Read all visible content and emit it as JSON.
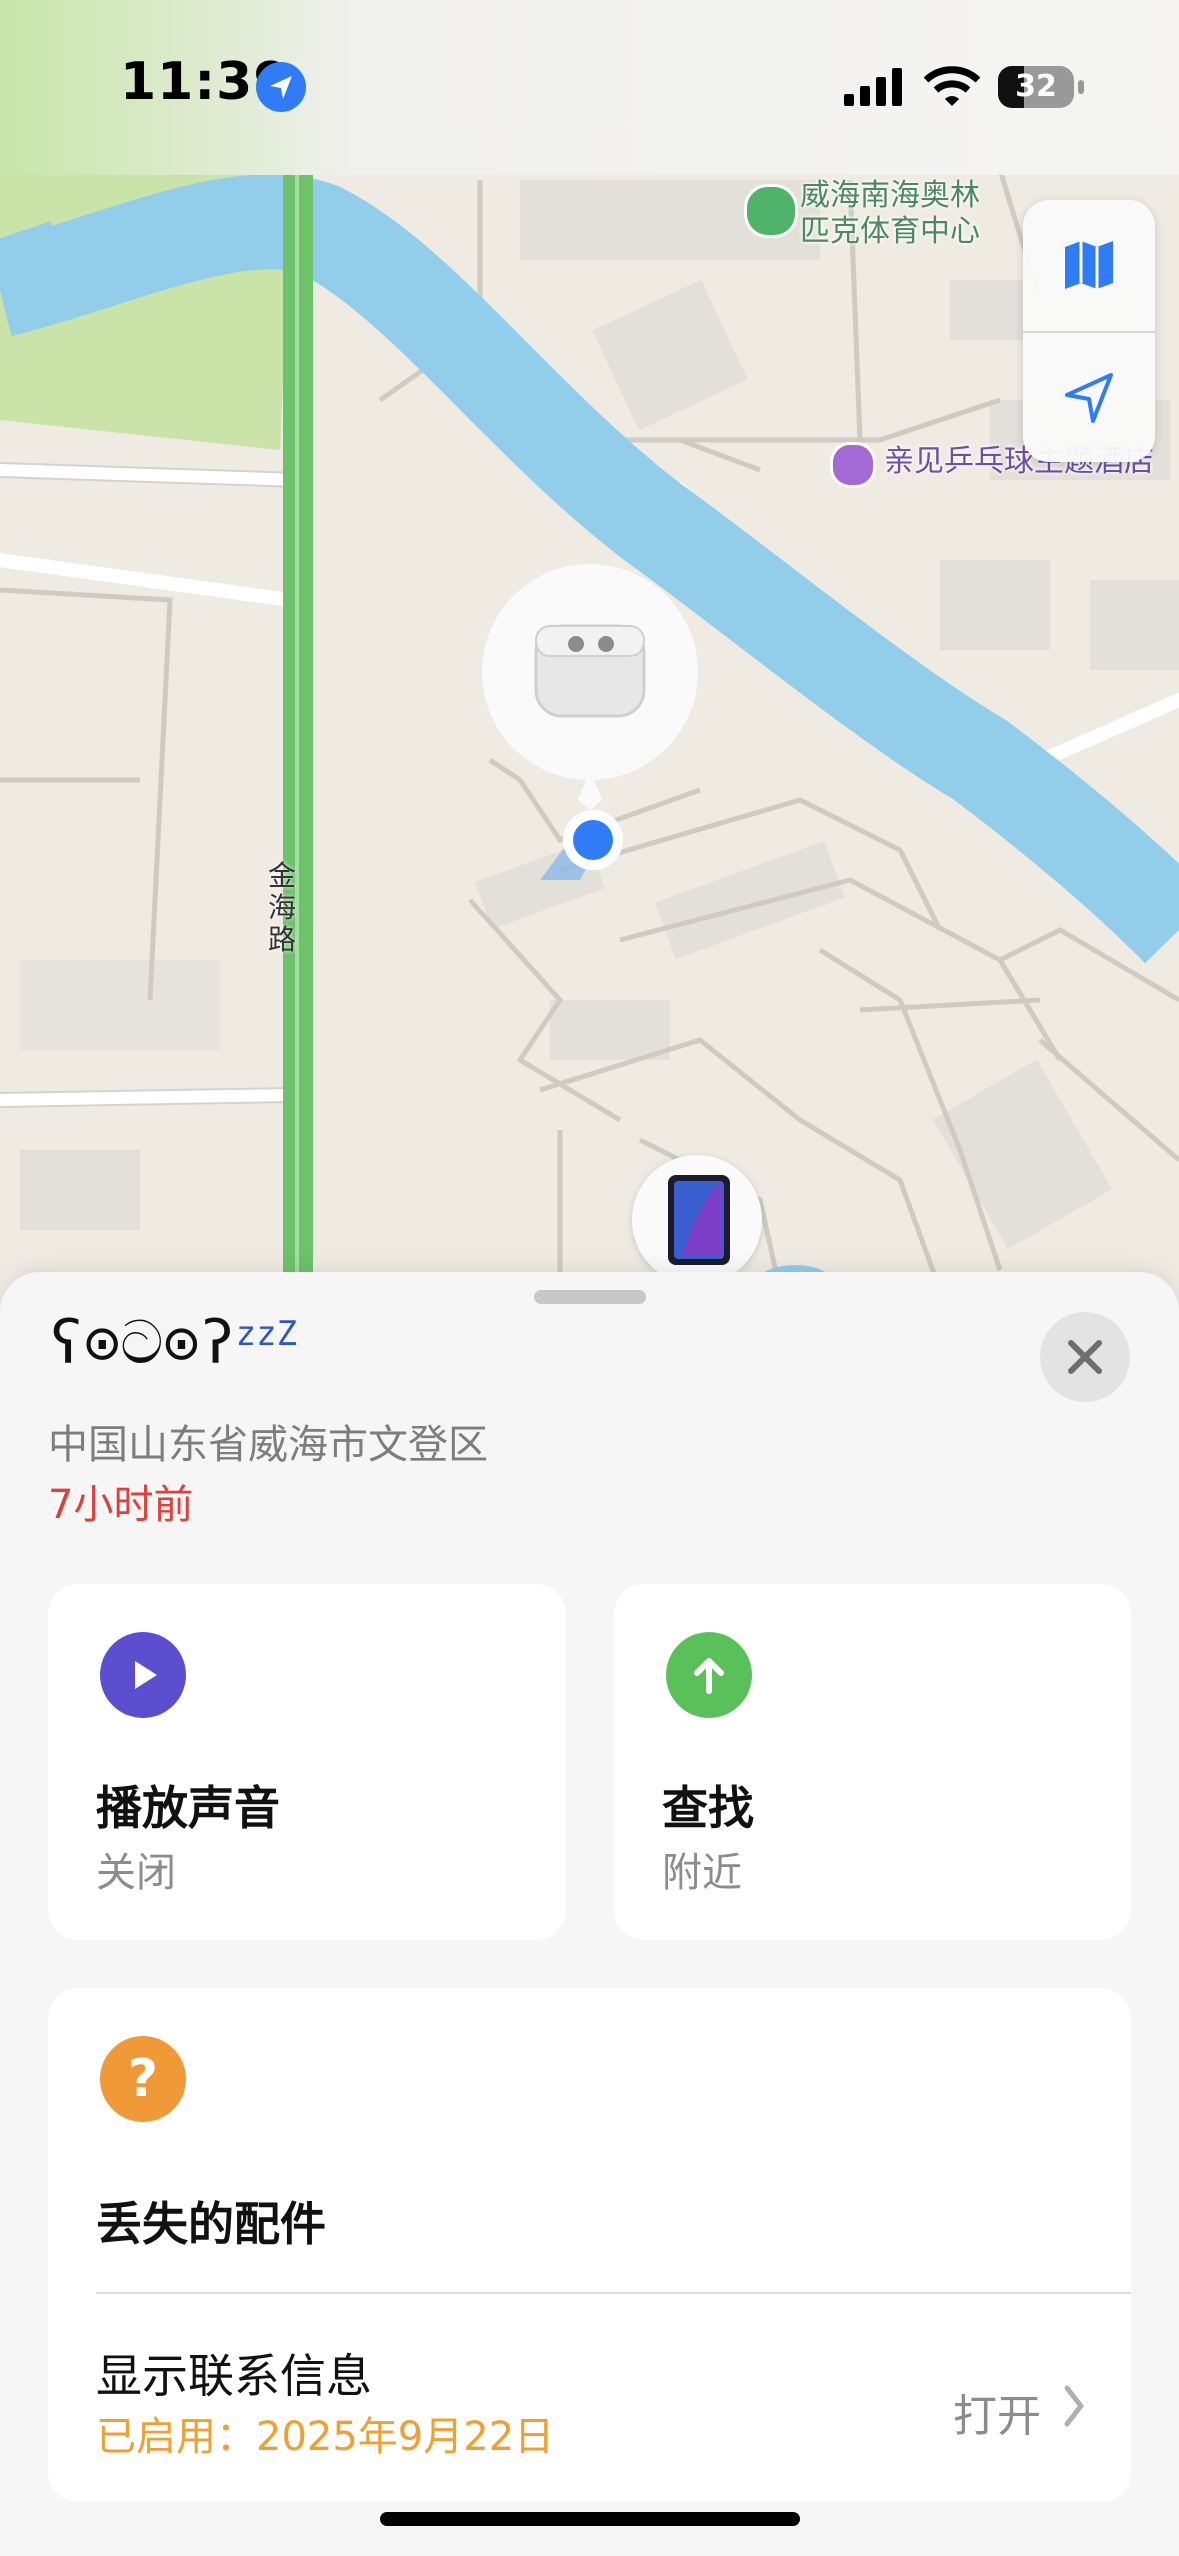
{
  "status_bar": {
    "time": "11:39",
    "battery": "32",
    "icons": [
      "location-arrow-icon",
      "cellular-signal-icon",
      "wifi-icon",
      "battery-icon"
    ]
  },
  "map": {
    "poi_stadium_line1": "威海南海奥林",
    "poi_stadium_line2": "匹克体育中心",
    "poi_hotel": "亲见乒乓球主题酒店",
    "road_name": "金海路",
    "colors": {
      "water": "#92cde9",
      "road_green": "#6cc36a",
      "land": "#efebe3",
      "park": "#c9e3a9"
    }
  },
  "device_panel": {
    "name": "ʕ⊙ට⊙ʔ",
    "name_suffix": "zzZ",
    "location": "中国山东省威海市文登区",
    "last_seen": "7小时前"
  },
  "actions": {
    "play_sound": {
      "title": "播放声音",
      "sub": "关闭",
      "color": "#5b4fcf"
    },
    "find": {
      "title": "查找",
      "sub": "附近",
      "color": "#5ac05a"
    }
  },
  "lost_accessory": {
    "title": "丢失的配件",
    "icon_color": "#f09a37",
    "contact_label": "显示联系信息",
    "enabled_text": "已启用：2025年9月22日",
    "open_label": "打开"
  }
}
